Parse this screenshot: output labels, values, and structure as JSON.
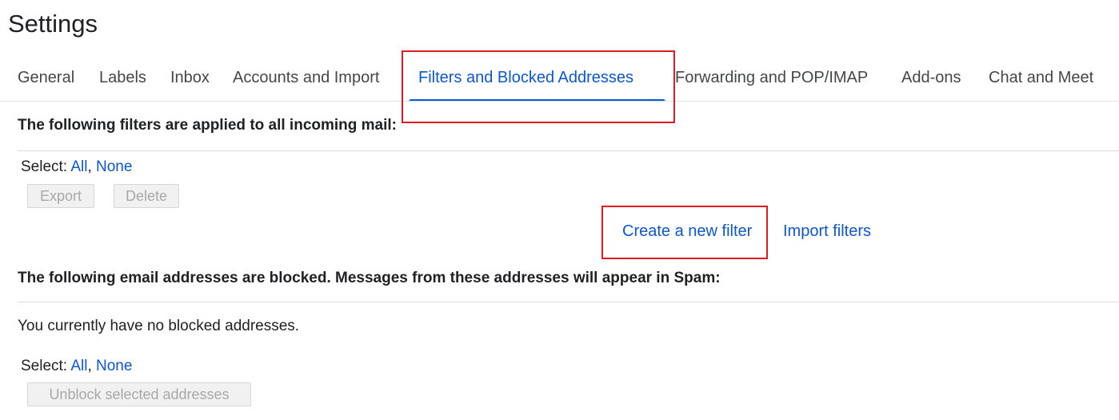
{
  "page": {
    "title": "Settings"
  },
  "tabs": [
    {
      "label": "General"
    },
    {
      "label": "Labels"
    },
    {
      "label": "Inbox"
    },
    {
      "label": "Accounts and Import"
    },
    {
      "label": "Filters and Blocked Addresses"
    },
    {
      "label": "Forwarding and POP/IMAP"
    },
    {
      "label": "Add-ons"
    },
    {
      "label": "Chat and Meet"
    }
  ],
  "active_tab": "Filters and Blocked Addresses",
  "filters": {
    "heading": "The following filters are applied to all incoming mail:",
    "select_label": "Select:",
    "select_all": "All",
    "separator": ",",
    "select_none": "None",
    "export_label": "Export",
    "delete_label": "Delete",
    "create_label": "Create a new filter",
    "import_label": "Import filters"
  },
  "blocked": {
    "heading": "The following email addresses are blocked. Messages from these addresses will appear in Spam:",
    "empty_text": "You currently have no blocked addresses.",
    "select_label": "Select:",
    "select_all": "All",
    "separator": ",",
    "select_none": "None",
    "unblock_label": "Unblock selected addresses"
  },
  "colors": {
    "accent": "#0b57d0",
    "highlight": "#e01b24",
    "disabled_text": "#a8a8a8"
  }
}
